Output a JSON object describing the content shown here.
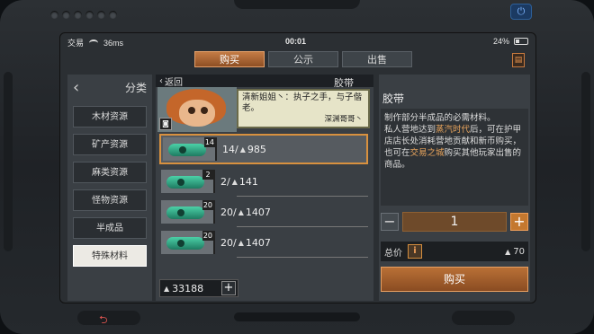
{
  "status": {
    "carrier": "交易",
    "speed": "36ms",
    "time": "00:01",
    "battery": "24%"
  },
  "tabs": [
    {
      "label": "购买",
      "active": true
    },
    {
      "label": "公示"
    },
    {
      "label": "出售"
    }
  ],
  "sidebar": {
    "title": "分类",
    "items": [
      {
        "label": "木材资源"
      },
      {
        "label": "矿产资源"
      },
      {
        "label": "麻类资源"
      },
      {
        "label": "怪物资源"
      },
      {
        "label": "半成品"
      },
      {
        "label": "特殊材料",
        "active": true
      }
    ]
  },
  "middle": {
    "back_label": "返回",
    "title": "胶带",
    "banner": {
      "line1": "清新姐姐丶：执子之手，与子偕老。",
      "signature": "深渊哥哥丶"
    },
    "items": [
      {
        "badge": "14",
        "stock": "14/",
        "price": "985",
        "active": true
      },
      {
        "badge": "2",
        "stock": "2/",
        "price": "141"
      },
      {
        "badge": "20",
        "stock": "20/",
        "price": "1407"
      },
      {
        "badge": "20",
        "stock": "20/",
        "price": "1407"
      }
    ],
    "wallet": "33188"
  },
  "detail": {
    "title": "胶带",
    "desc_1": "制作部分半成品的必需材料。",
    "desc_2a": "私人营地达到",
    "desc_2b": "蒸汽时代",
    "desc_2c": "后，可在护甲店店长处消耗营地贡献和新币购买，也可在",
    "desc_2d": "交易之城",
    "desc_2e": "购买其他玩家出售的商品。",
    "quantity": "1",
    "total_label": "总价",
    "total_value": "70",
    "buy_label": "购买"
  },
  "colors": {
    "accent": "#c4782f",
    "highlight": "#e8a45c",
    "tape": "#4bd1a8"
  }
}
